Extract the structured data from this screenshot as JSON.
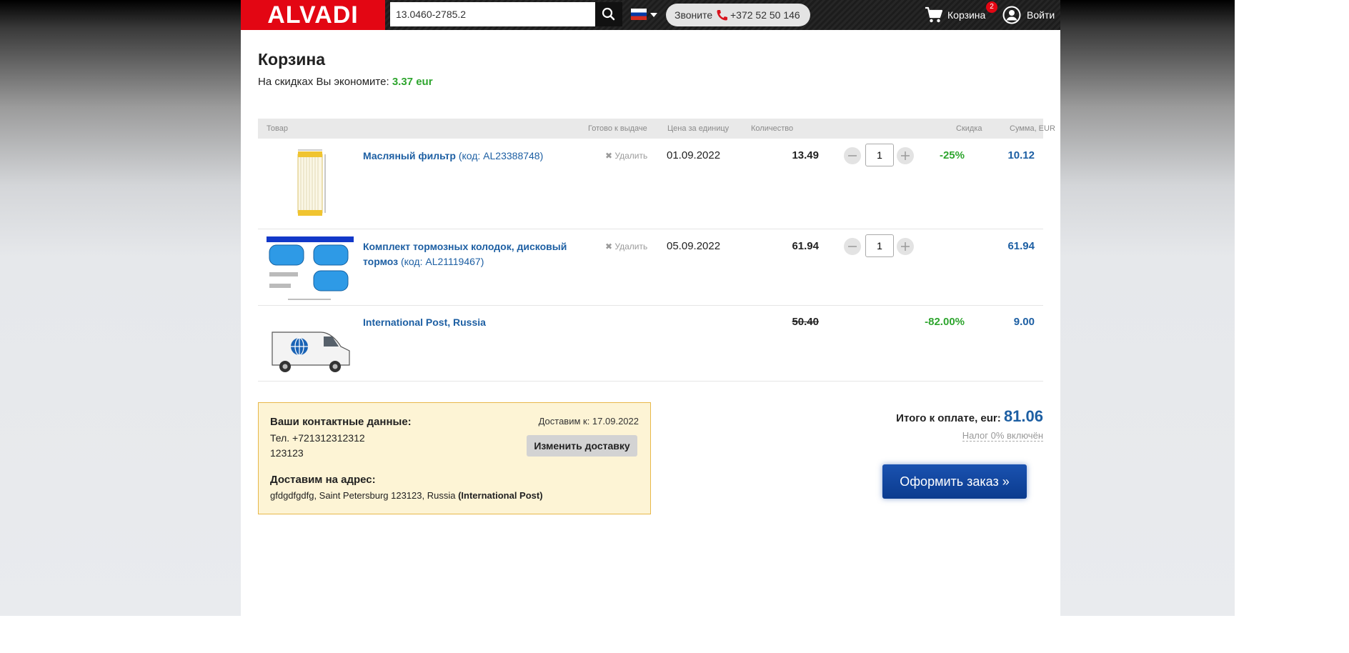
{
  "header": {
    "logo": "ALVADI",
    "search": {
      "value": "13.0460-2785.2",
      "placeholder": ""
    },
    "call": {
      "label": "Звоните",
      "phone": "+372 52 50 146"
    },
    "cart": {
      "label": "Корзина",
      "count": "2"
    },
    "login": {
      "label": "Войти"
    }
  },
  "page": {
    "title": "Корзина",
    "savings_label": "На скидках Вы экономите:",
    "savings_value": "3.37 eur"
  },
  "table": {
    "headers": {
      "product": "Товар",
      "ready": "Готово к выдаче",
      "unit_price": "Цена за единицу",
      "qty": "Количество",
      "discount": "Скидка",
      "sum": "Сумма, EUR"
    },
    "delete_label": "✖ Удалить",
    "rows": [
      {
        "name": "Масляный фильтр",
        "code": "(код: AL23388748)",
        "date": "01.09.2022",
        "price": "13.49",
        "qty": "1",
        "discount": "-25%",
        "sum": "10.12"
      },
      {
        "name": "Комплект тормозных колодок, дисковый тормоз",
        "code": "(код: AL21119467)",
        "date": "05.09.2022",
        "price": "61.94",
        "qty": "1",
        "discount": "",
        "sum": "61.94"
      },
      {
        "name": "International Post, Russia",
        "price": "50.40",
        "discount": "-82.00%",
        "sum": "9.00"
      }
    ]
  },
  "contact": {
    "title": "Ваши контактные данные:",
    "tel": "Тел. +721312312312",
    "code": "123123",
    "delivery_date": "Доставим к: 17.09.2022",
    "change_button": "Изменить доставку",
    "address_title": "Доставим на адрес:",
    "address": "gfdgdfgdfg, Saint Petersburg 123123, Russia",
    "carrier": "(International Post)"
  },
  "summary": {
    "total_label": "Итого к оплате, eur:",
    "total_value": "81.06",
    "tax": "Налог 0% включён",
    "order_button": "Оформить заказ »"
  },
  "colors": {
    "brand_red": "#e30613",
    "link_blue": "#1d5fa3",
    "discount_green": "#2ea52e",
    "button_blue": "#0b3b8e"
  },
  "icons": [
    "search-icon",
    "flag-ru-icon",
    "phone-icon",
    "cart-icon",
    "user-icon",
    "minus-icon",
    "plus-icon"
  ]
}
